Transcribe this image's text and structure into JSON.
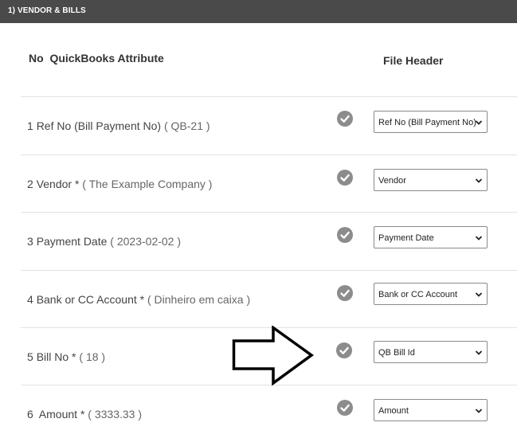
{
  "section": {
    "title": "1) VENDOR & BILLS"
  },
  "headers": {
    "col1": "No  QuickBooks Attribute",
    "col2": "File Header"
  },
  "rows": [
    {
      "no": "1",
      "attribute": "Ref No (Bill Payment No)",
      "required": "",
      "sample": "( QB-21 )",
      "mapped": "Ref No (Bill Payment No)"
    },
    {
      "no": "2",
      "attribute": "Vendor",
      "required": "*",
      "sample": "( The Example Company )",
      "mapped": "Vendor"
    },
    {
      "no": "3",
      "attribute": "Payment Date",
      "required": "",
      "sample": "( 2023-02-02 )",
      "mapped": "Payment Date"
    },
    {
      "no": "4",
      "attribute": "Bank or CC Account",
      "required": "*",
      "sample": "( Dinheiro em caixa )",
      "mapped": "Bank or CC Account"
    },
    {
      "no": "5",
      "attribute": "Bill No",
      "required": "*",
      "sample": "( 18 )",
      "mapped": "QB Bill Id"
    },
    {
      "no": "6",
      "attribute": " Amount",
      "required": "*",
      "sample": "( 3333.33 )",
      "mapped": "Amount"
    }
  ],
  "icons": {
    "status": "check-circle-icon",
    "dropdown": "chevron-down-icon",
    "annotation": "right-arrow-outline-icon"
  },
  "colors": {
    "topbar": "#4a4a4a",
    "check": "#8c8c8c"
  }
}
